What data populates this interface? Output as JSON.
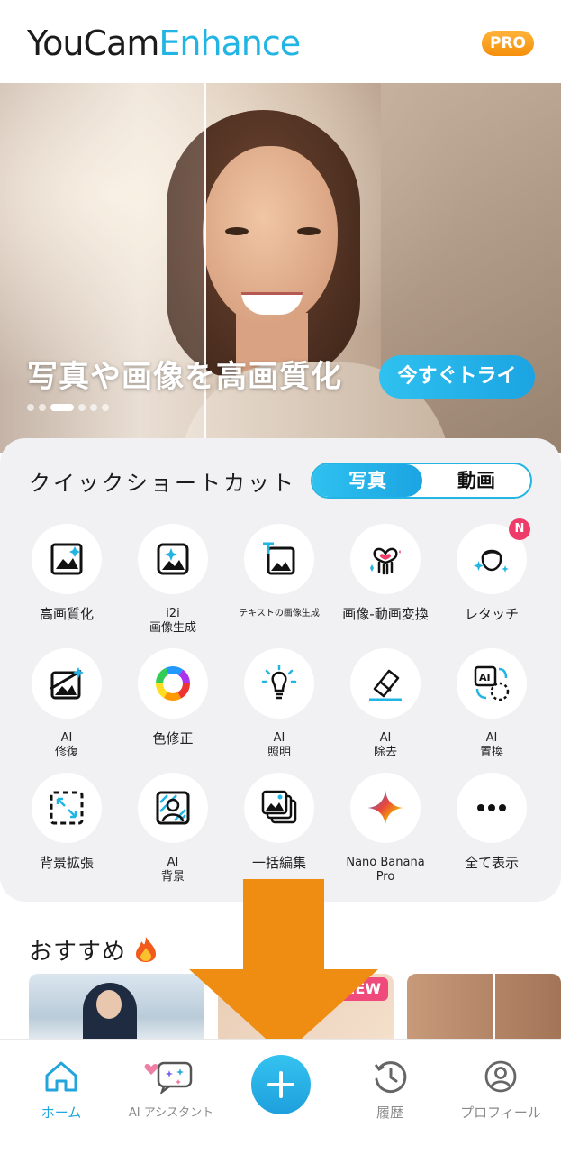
{
  "header": {
    "logo_part1": "YouCam",
    "logo_part2": "Enhance",
    "pro_badge": "PRO"
  },
  "hero": {
    "title": "写真や画像を高画質化",
    "cta": "今すぐトライ",
    "page_count": 6,
    "active_page": 3
  },
  "shortcuts": {
    "title": "クイックショートカット",
    "tabs": [
      {
        "label": "写真",
        "active": true
      },
      {
        "label": "動画",
        "active": false
      }
    ],
    "rows": [
      [
        {
          "icon": "image-enhance-icon",
          "label": "高画質化"
        },
        {
          "icon": "i2i-sparkle-icon",
          "label": "i2i",
          "label2": "画像生成"
        },
        {
          "icon": "text-to-image-icon",
          "label": "テキストの画像生成"
        },
        {
          "icon": "image-to-video-icon",
          "label": "画像-動画変換"
        },
        {
          "icon": "retouch-face-icon",
          "label": "レタッチ",
          "badge": "N"
        }
      ],
      [
        {
          "icon": "ai-restore-icon",
          "label": "AI",
          "label2": "修復"
        },
        {
          "icon": "color-wheel-icon",
          "label": "色修正"
        },
        {
          "icon": "light-bulb-icon",
          "label": "AI",
          "label2": "照明"
        },
        {
          "icon": "eraser-icon",
          "label": "AI",
          "label2": "除去"
        },
        {
          "icon": "ai-replace-icon",
          "label": "AI",
          "label2": "置換"
        }
      ],
      [
        {
          "icon": "expand-icon",
          "label": "背景拡張"
        },
        {
          "icon": "ai-background-icon",
          "label": "AI",
          "label2": "背景"
        },
        {
          "icon": "batch-edit-icon",
          "label": "一括編集"
        },
        {
          "icon": "gemini-star-icon",
          "label": "Nano Banana",
          "label2": "Pro"
        },
        {
          "icon": "more-icon",
          "label": "全て表示"
        }
      ]
    ]
  },
  "recommended": {
    "title": "おすすめ",
    "title_icon": "fire-icon",
    "new_badge": "NEW"
  },
  "nav": {
    "items": [
      {
        "icon": "home-icon",
        "label": "ホーム",
        "active": true
      },
      {
        "icon": "ai-assistant-icon",
        "label": "AI アシスタント"
      },
      {
        "icon": "plus-icon",
        "label": ""
      },
      {
        "icon": "history-icon",
        "label": "履歴"
      },
      {
        "icon": "profile-icon",
        "label": "プロフィール"
      }
    ]
  },
  "colors": {
    "accent": "#22b5e3",
    "pro": "#f7a21b",
    "arrow": "#ef8c12",
    "badge": "#ee3b6a"
  }
}
